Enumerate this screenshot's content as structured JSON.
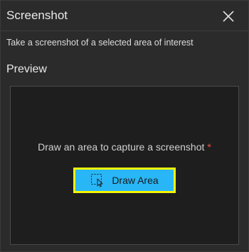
{
  "header": {
    "title": "Screenshot",
    "close_icon": "close-icon"
  },
  "subtitle": "Take a screenshot of a selected area of interest",
  "preview": {
    "label": "Preview",
    "instruction": "Draw an area to capture a screenshot",
    "required_marker": "*",
    "draw_button": {
      "label": "Draw Area",
      "icon": "select-area-icon"
    }
  },
  "colors": {
    "background": "#2b2b2b",
    "preview_bg": "#1e1e1e",
    "button_bg": "#29b6f6",
    "button_highlight": "#f5f500",
    "required": "#e8554e"
  }
}
